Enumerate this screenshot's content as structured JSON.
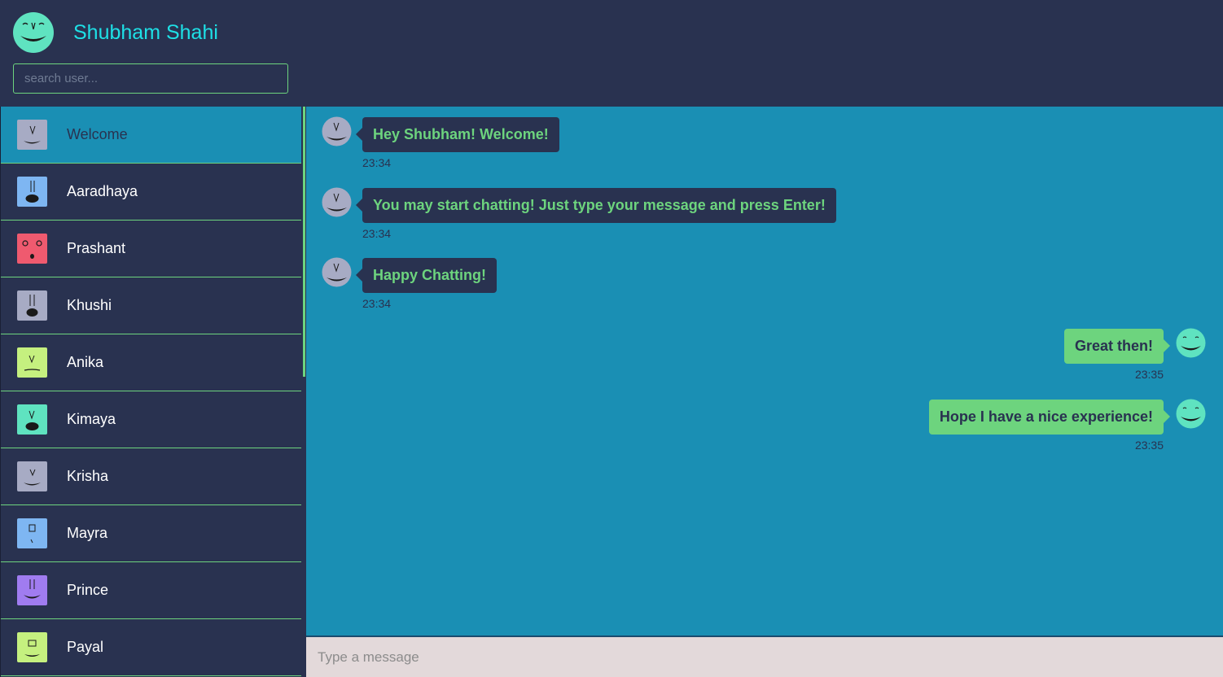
{
  "header": {
    "user_name": "Shubham Shahi",
    "search_placeholder": "search user..."
  },
  "sidebar": {
    "items": [
      {
        "label": "Welcome",
        "color": "#a7abc4",
        "active": true
      },
      {
        "label": "Aaradhaya",
        "color": "#7eb6f2"
      },
      {
        "label": "Prashant",
        "color": "#ef5a6f"
      },
      {
        "label": "Khushi",
        "color": "#a7abc4"
      },
      {
        "label": "Anika",
        "color": "#c5f07f"
      },
      {
        "label": "Kimaya",
        "color": "#5fe3c0"
      },
      {
        "label": "Krisha",
        "color": "#a7abc4"
      },
      {
        "label": "Mayra",
        "color": "#7eb6f2"
      },
      {
        "label": "Prince",
        "color": "#a07cf0"
      },
      {
        "label": "Payal",
        "color": "#c5f07f"
      }
    ]
  },
  "messages": [
    {
      "text": "Hey Shubham! Welcome!",
      "time": "23:34",
      "direction": "in"
    },
    {
      "text": "You may start chatting! Just type your message and press Enter!",
      "time": "23:34",
      "direction": "in"
    },
    {
      "text": "Happy Chatting!",
      "time": "23:34",
      "direction": "in"
    },
    {
      "text": "Great then!",
      "time": "23:35",
      "direction": "out"
    },
    {
      "text": "Hope I have a nice experience!",
      "time": "23:35",
      "direction": "out"
    }
  ],
  "composer": {
    "placeholder": "Type a message"
  },
  "colors": {
    "background": "#293250",
    "accent": "#6dd47e",
    "chat_bg": "#1a8fb4",
    "name": "#1ee0e6"
  }
}
